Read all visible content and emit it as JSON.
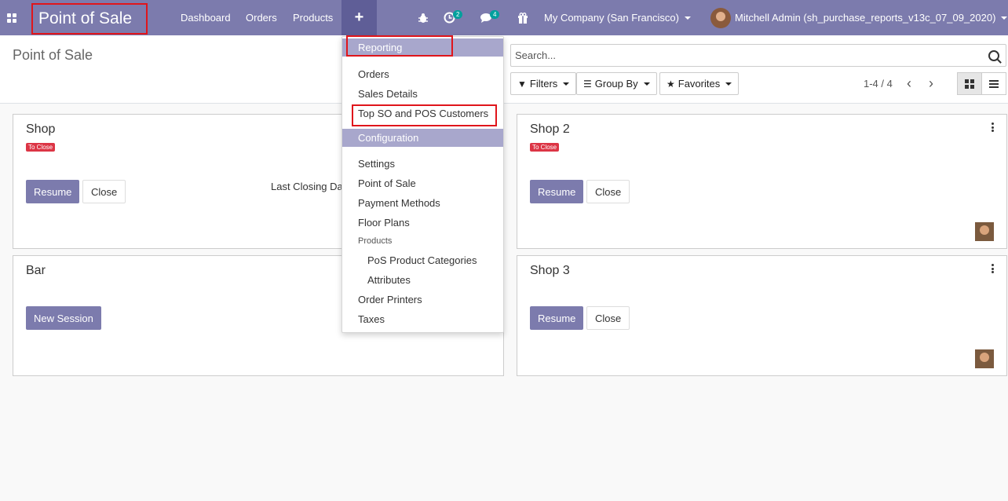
{
  "navbar": {
    "app_title": "Point of Sale",
    "menus": [
      "Dashboard",
      "Orders",
      "Products"
    ],
    "plus_label": "+",
    "activity_count": "2",
    "message_count": "4",
    "company": "My Company (San Francisco)",
    "user": "Mitchell Admin (sh_purchase_reports_v13c_07_09_2020)",
    "icons": [
      "apps-grid-icon",
      "bug-icon",
      "clock-icon",
      "chat-icon",
      "gift-icon"
    ]
  },
  "control_panel": {
    "title": "Point of Sale",
    "search_placeholder": "Search...",
    "filters_label": "Filters",
    "group_by_label": "Group By",
    "favorites_label": "Favorites",
    "pager": "1-4 / 4"
  },
  "cards": {
    "shop": {
      "title": "Shop",
      "badge": "To Close",
      "resume": "Resume",
      "close": "Close",
      "closing_label": "Last Closing Da"
    },
    "bar": {
      "title": "Bar",
      "new_session": "New Session"
    },
    "shop2": {
      "title": "Shop 2",
      "badge": "To Close",
      "resume": "Resume",
      "close": "Close"
    },
    "shop3": {
      "title": "Shop 3",
      "resume": "Resume",
      "close": "Close"
    }
  },
  "dropdown": {
    "reporting": "Reporting",
    "orders": "Orders",
    "sales_details": "Sales Details",
    "top_customers": "Top SO and POS Customers",
    "configuration": "Configuration",
    "settings": "Settings",
    "point_of_sale": "Point of Sale",
    "payment_methods": "Payment Methods",
    "floor_plans": "Floor Plans",
    "products": "Products",
    "pos_product_categories": "PoS Product Categories",
    "attributes": "Attributes",
    "order_printers": "Order Printers",
    "taxes": "Taxes"
  },
  "colors": {
    "brand": "#7c7bad",
    "highlight": "#e0151b",
    "badge": "#dc3545",
    "counter": "#00a09d"
  }
}
